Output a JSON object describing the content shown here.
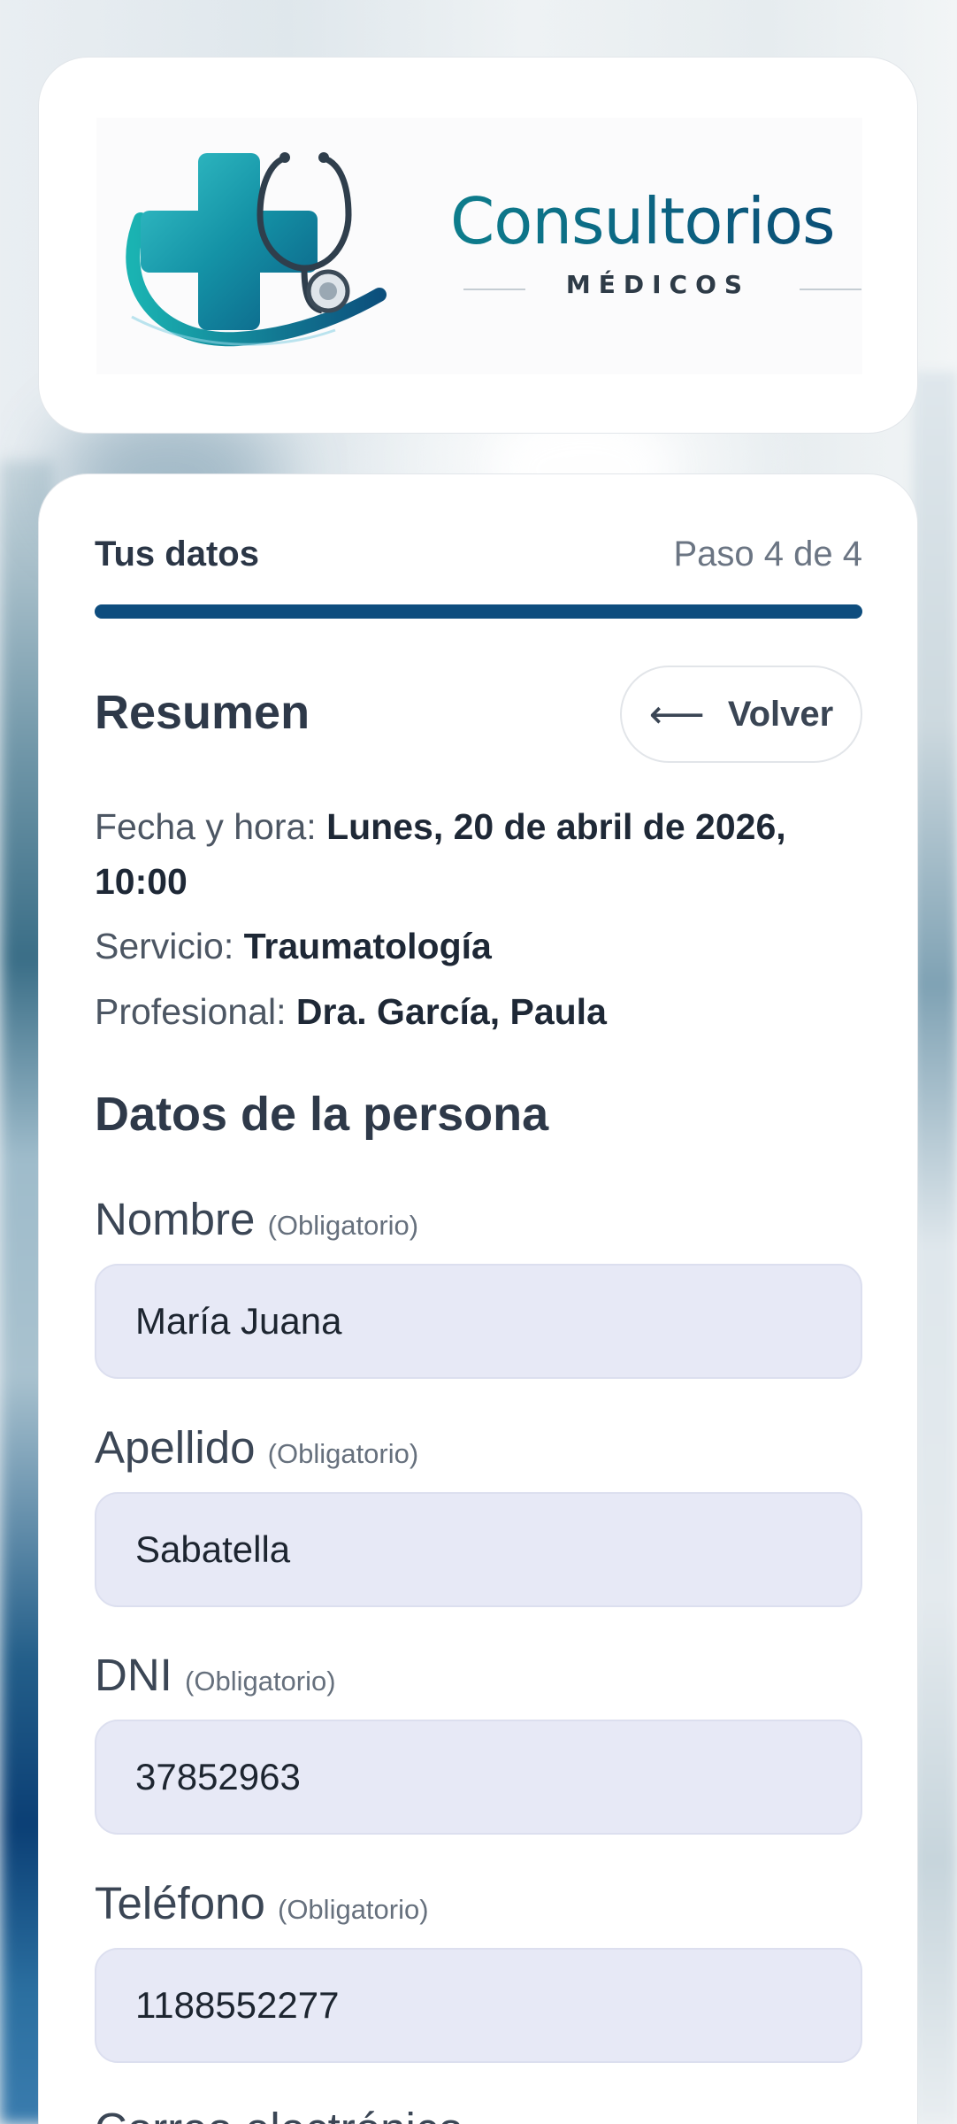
{
  "brand": {
    "name": "Consultorios",
    "subtitle": "MÉDICOS"
  },
  "progress": {
    "step_title": "Tus datos",
    "step_counter": "Paso 4 de 4",
    "fraction": 1.0
  },
  "summary": {
    "title": "Resumen",
    "back_label": "Volver",
    "date_label": "Fecha y hora: ",
    "date_value": "Lunes, 20 de abril de 2026, 10:00",
    "service_label": "Servicio: ",
    "service_value": "Traumatología",
    "professional_label": "Profesional: ",
    "professional_value": "Dra. García, Paula"
  },
  "person": {
    "title": "Datos de la persona",
    "required_tag": "(Obligatorio)",
    "fields": [
      {
        "label": "Nombre",
        "value": "María Juana"
      },
      {
        "label": "Apellido",
        "value": "Sabatella"
      },
      {
        "label": "DNI",
        "value": "37852963"
      },
      {
        "label": "Teléfono",
        "value": "1188552277"
      }
    ],
    "next_field_label": "Correo electrónico"
  },
  "colors": {
    "brand_teal": "#0d7d8c",
    "brand_navy": "#0e4d7e",
    "input_bg": "#e7e9f6"
  }
}
